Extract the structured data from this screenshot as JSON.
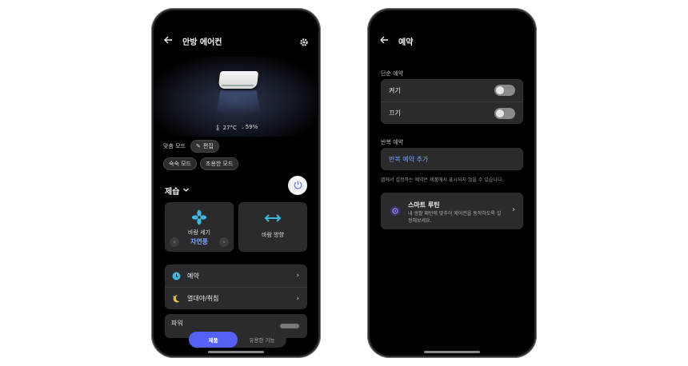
{
  "left_screen": {
    "title": "안방 에어컨",
    "temperature": "27°C",
    "humidity": "59%",
    "mode_label": "맞춤 모드",
    "edit_chip": "편집",
    "mode_chips": [
      "숙숙 모드",
      "조용한 모드"
    ],
    "operation_mode": "제습",
    "wind_card": {
      "label": "바람 세기",
      "value": "자연풍"
    },
    "direction_card": {
      "label": "바람 방향"
    },
    "menu": [
      {
        "label": "예약"
      },
      {
        "label": "열대야/취침"
      }
    ],
    "partial_item": "파워",
    "bottom_nav": {
      "active": "제품",
      "other": "유용한 기능"
    },
    "colors": {
      "accent": "#5561f2",
      "value_blue": "#7aa4ff",
      "card_bg": "#2b2b2e"
    }
  },
  "right_screen": {
    "title": "예약",
    "simple_section": "단순 예약",
    "simple_rows": [
      {
        "label": "켜기",
        "on": false
      },
      {
        "label": "끄기",
        "on": false
      }
    ],
    "repeat_section": "반복 예약",
    "add_repeat": "반복 예약 추가",
    "note": "앱에서 설정하는 예약은 제품에서 표시되지 않을 수 있습니다.",
    "routine": {
      "title": "스마트 루틴",
      "desc": "내 생활 패턴에 맞추어 에어컨을 동작하도록 설정해보세요."
    }
  },
  "icons": [
    "back-arrow-icon",
    "gear-icon",
    "thermometer-icon",
    "droplet-icon",
    "pencil-icon",
    "chevron-down-icon",
    "power-icon",
    "fan-icon",
    "swing-arrows-icon",
    "clock-icon",
    "moon-icon",
    "chevron-right-icon",
    "routine-icon"
  ]
}
